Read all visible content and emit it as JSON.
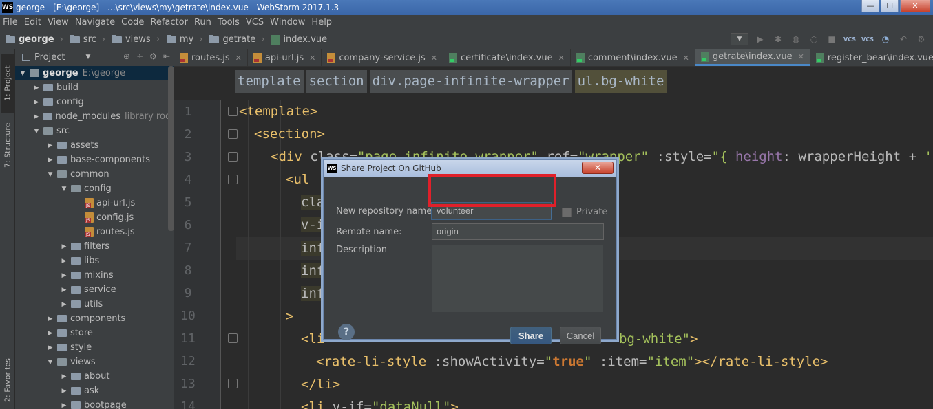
{
  "window": {
    "title": "george - [E:\\george] - ...\\src\\views\\my\\getrate\\index.vue - WebStorm 2017.1.3",
    "logo": "WS"
  },
  "menu": [
    "File",
    "Edit",
    "View",
    "Navigate",
    "Code",
    "Refactor",
    "Run",
    "Tools",
    "VCS",
    "Window",
    "Help"
  ],
  "nav_breadcrumb": [
    "george",
    "src",
    "views",
    "my",
    "getrate",
    "index.vue"
  ],
  "toolstripe": {
    "project_tab": "1: Project",
    "structure_tab": "7: Structure",
    "favorites_tab": "2: Favorites"
  },
  "project_panel": {
    "header": "Project",
    "tree": [
      {
        "label": "george",
        "extra": "E:\\george",
        "depth": 0,
        "open": true,
        "type": "folder"
      },
      {
        "label": "build",
        "extra": "",
        "depth": 1,
        "open": false,
        "type": "folder"
      },
      {
        "label": "config",
        "extra": "",
        "depth": 1,
        "open": false,
        "type": "folder"
      },
      {
        "label": "node_modules",
        "extra": "library root",
        "depth": 1,
        "open": false,
        "type": "folder"
      },
      {
        "label": "src",
        "extra": "",
        "depth": 1,
        "open": true,
        "type": "folder"
      },
      {
        "label": "assets",
        "extra": "",
        "depth": 2,
        "open": false,
        "type": "folder"
      },
      {
        "label": "base-components",
        "extra": "",
        "depth": 2,
        "open": false,
        "type": "folder"
      },
      {
        "label": "common",
        "extra": "",
        "depth": 2,
        "open": true,
        "type": "folder"
      },
      {
        "label": "config",
        "extra": "",
        "depth": 3,
        "open": true,
        "type": "folder"
      },
      {
        "label": "api-url.js",
        "extra": "",
        "depth": 4,
        "open": false,
        "type": "js"
      },
      {
        "label": "config.js",
        "extra": "",
        "depth": 4,
        "open": false,
        "type": "js"
      },
      {
        "label": "routes.js",
        "extra": "",
        "depth": 4,
        "open": false,
        "type": "js"
      },
      {
        "label": "filters",
        "extra": "",
        "depth": 3,
        "open": false,
        "type": "folder"
      },
      {
        "label": "libs",
        "extra": "",
        "depth": 3,
        "open": false,
        "type": "folder"
      },
      {
        "label": "mixins",
        "extra": "",
        "depth": 3,
        "open": false,
        "type": "folder"
      },
      {
        "label": "service",
        "extra": "",
        "depth": 3,
        "open": false,
        "type": "folder"
      },
      {
        "label": "utils",
        "extra": "",
        "depth": 3,
        "open": false,
        "type": "folder"
      },
      {
        "label": "components",
        "extra": "",
        "depth": 2,
        "open": false,
        "type": "folder"
      },
      {
        "label": "store",
        "extra": "",
        "depth": 2,
        "open": false,
        "type": "folder"
      },
      {
        "label": "style",
        "extra": "",
        "depth": 2,
        "open": false,
        "type": "folder"
      },
      {
        "label": "views",
        "extra": "",
        "depth": 2,
        "open": true,
        "type": "folder"
      },
      {
        "label": "about",
        "extra": "",
        "depth": 3,
        "open": false,
        "type": "folder"
      },
      {
        "label": "ask",
        "extra": "",
        "depth": 3,
        "open": false,
        "type": "folder"
      },
      {
        "label": "bootpage",
        "extra": "",
        "depth": 3,
        "open": false,
        "type": "folder"
      }
    ]
  },
  "editor": {
    "tabs": [
      {
        "label": "routes.js",
        "type": "js",
        "active": false
      },
      {
        "label": "api-url.js",
        "type": "js",
        "active": false
      },
      {
        "label": "company-service.js",
        "type": "js",
        "active": false
      },
      {
        "label": "certificate\\index.vue",
        "type": "vue",
        "active": false
      },
      {
        "label": "comment\\index.vue",
        "type": "vue",
        "active": false
      },
      {
        "label": "getrate\\index.vue",
        "type": "vue",
        "active": true
      },
      {
        "label": "register_bear\\index.vue",
        "type": "vue",
        "active": false
      }
    ],
    "breadcrumb": [
      "template",
      "section",
      "div.page-infinite-wrapper",
      "ul.bg-white"
    ],
    "line_numbers": [
      "1",
      "2",
      "3",
      "4",
      "5",
      "6",
      "7",
      "8",
      "9",
      "10",
      "11",
      "12",
      "13",
      "14"
    ],
    "code": {
      "l1": "<template>",
      "l2": "<section>",
      "l3_open": "<div ",
      "l3_attr1": "class=",
      "l3_str1": "\"page-infinite-wrapper\"",
      "l3_attr2": " ref=",
      "l3_str2": "\"wrapper\"",
      "l3_attr3": " :style=",
      "l3_str3": "\"{ ",
      "l3_prop": "height",
      "l3_rest": ": wrapperHeight + ",
      "l3_str4": "'px'",
      "l4": "<ul",
      "l5": "cla",
      "l6": "v-i",
      "l7": "inf",
      "l8": "inf",
      "l9": "inf",
      "l10": ">",
      "l11_tag": "<li",
      "l11_str": "bg-white\"",
      "l11_end": ">",
      "l12_tag": "<rate-li-style ",
      "l12_attr1": ":showActivity=",
      "l12_q": "\"",
      "l12_kw": "true",
      "l12_q2": "\"",
      "l12_attr2": " :item=",
      "l12_str": "\"item\"",
      "l12_end": "></rate-li-style>",
      "l13": "</li>",
      "l14_tag": "<li ",
      "l14_attr": "v-if=",
      "l14_str": "\"dataNull\"",
      "l14_end": ">"
    }
  },
  "dialog": {
    "title": "Share Project On GitHub",
    "close": "✕",
    "repo_label": "New repository name:",
    "repo_value": "volunteer",
    "private_label": "Private",
    "private_checked": false,
    "remote_label": "Remote name:",
    "remote_value": "origin",
    "description_label": "Description",
    "help": "?",
    "share_button": "Share",
    "cancel_button": "Cancel"
  },
  "colors": {
    "accent": "#4a88c7",
    "highlight_box": "#e0202a"
  }
}
